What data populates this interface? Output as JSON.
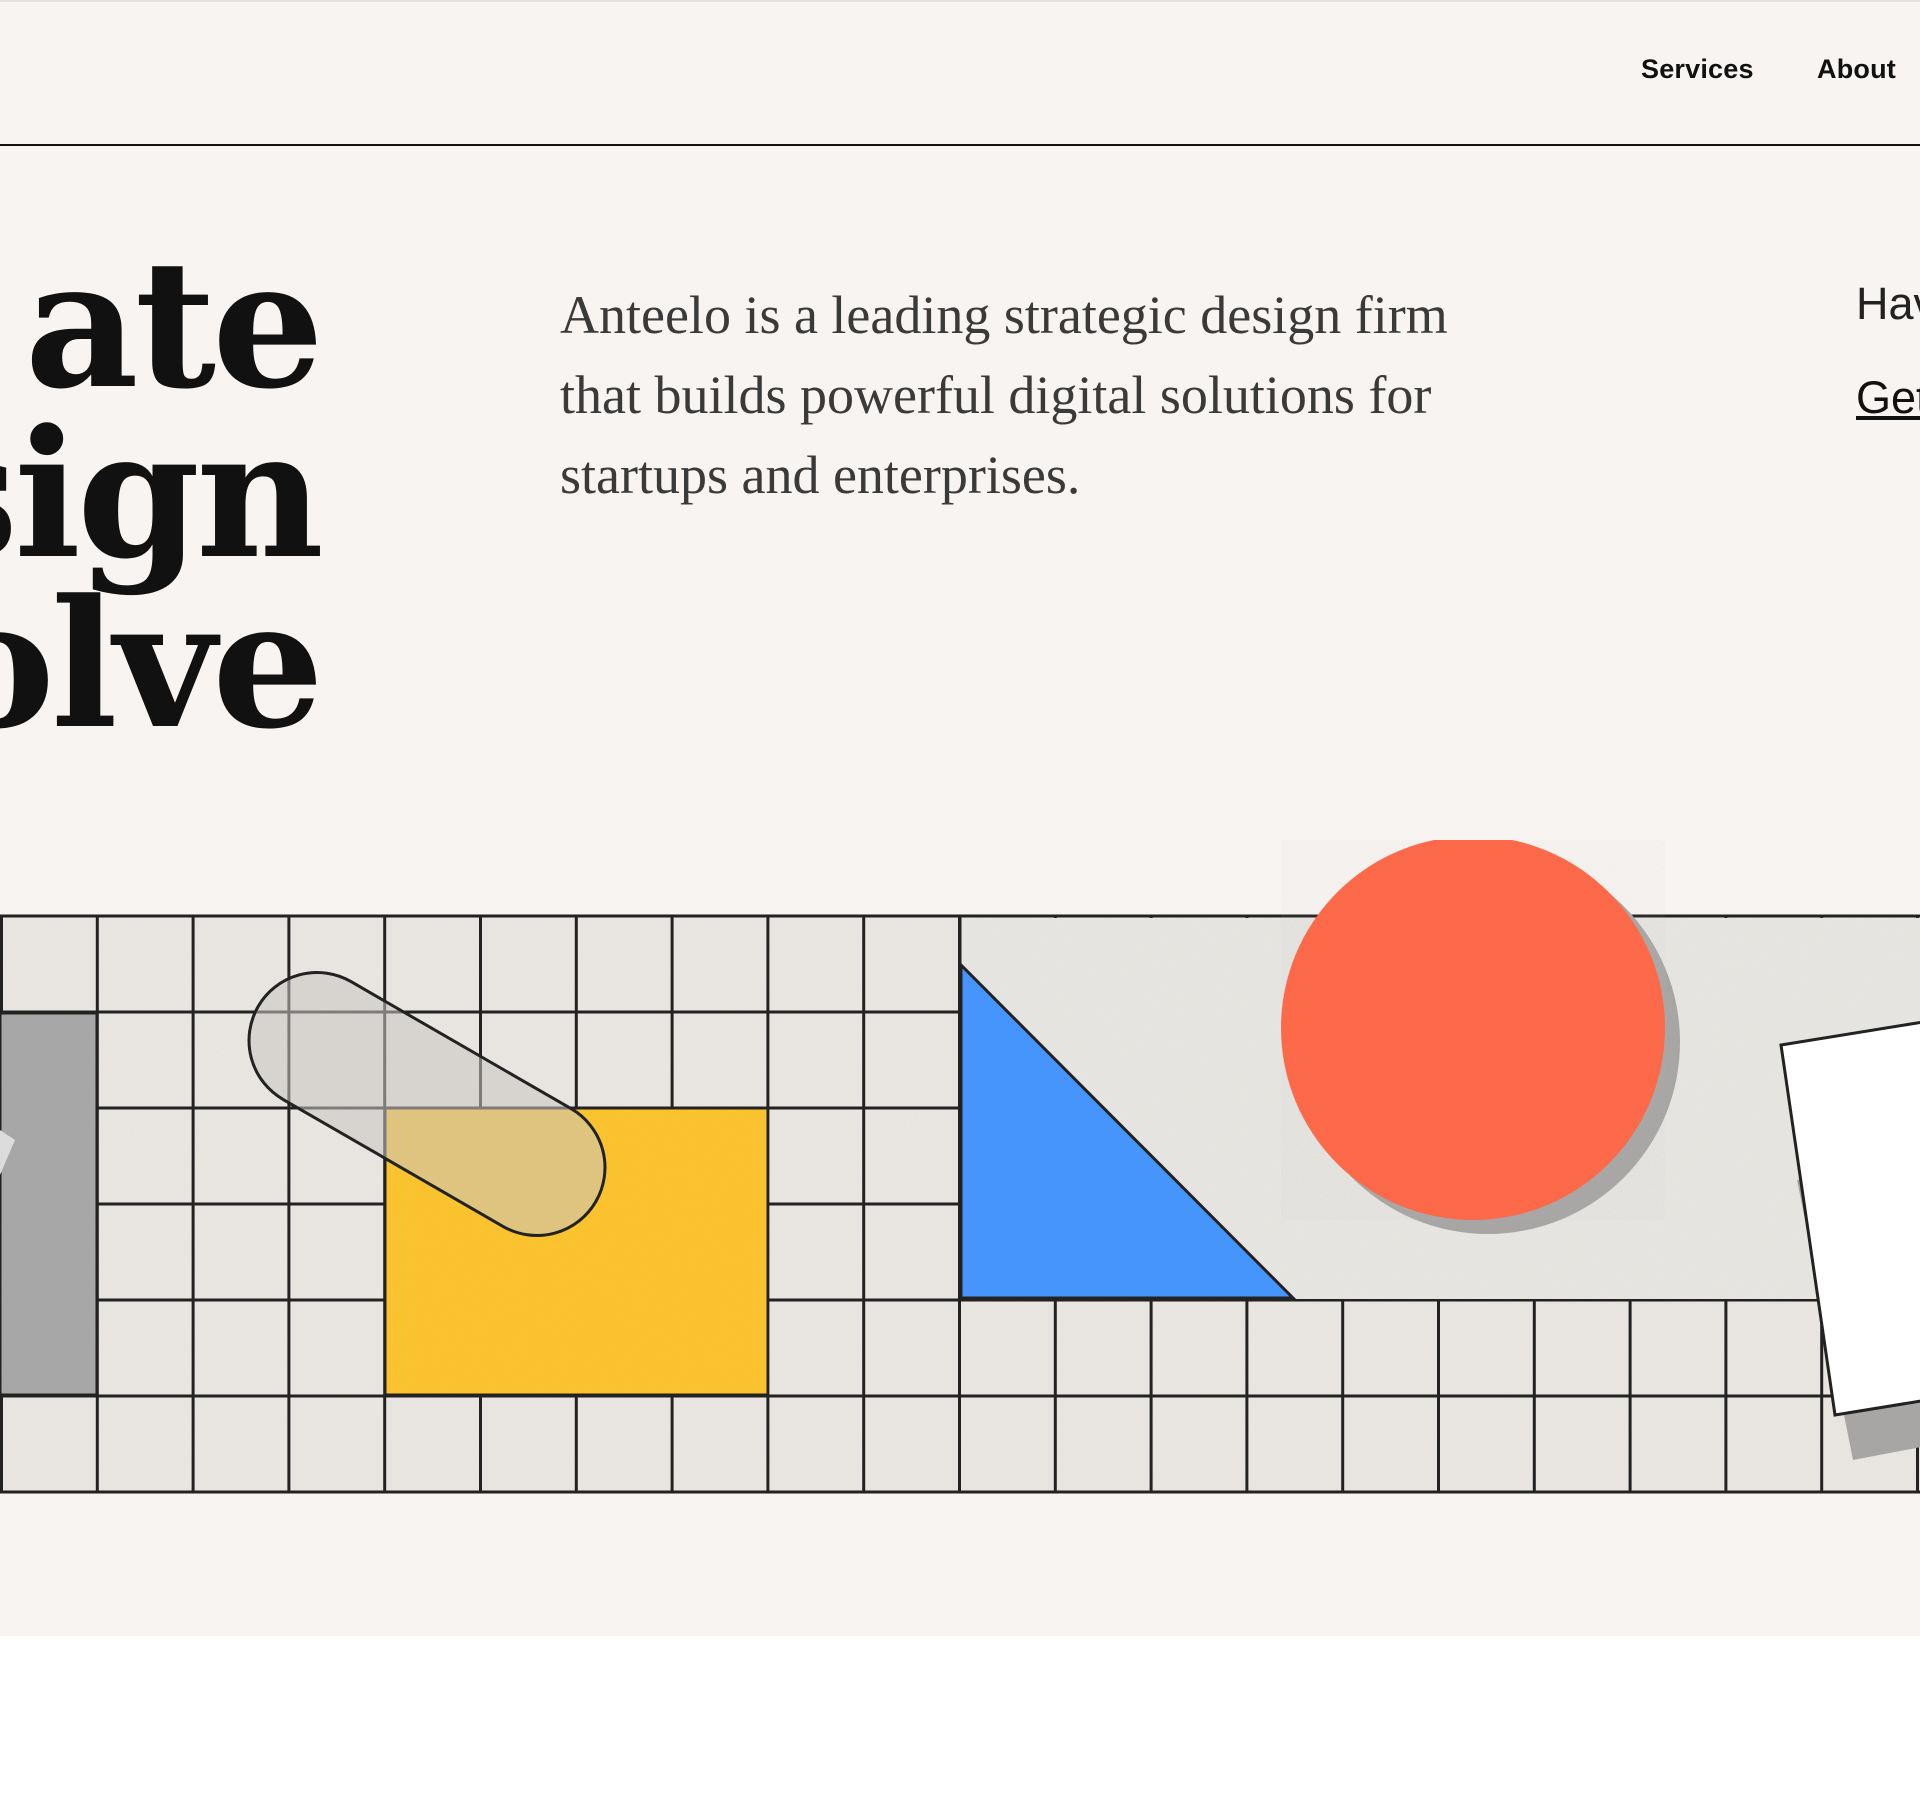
{
  "nav": {
    "items": [
      {
        "label": "Services"
      },
      {
        "label": "About"
      }
    ]
  },
  "hero": {
    "headline_lines": [
      "ate",
      "sign",
      "olve"
    ],
    "description_lines": [
      "Anteelo is a leading strategic design firm",
      "that builds powerful digital solutions for",
      "startups and enterprises."
    ],
    "cta_question": "Hav",
    "cta_link": "Get"
  },
  "illustration": {
    "colors": {
      "grid_fill": "#ebe8e4",
      "grid_line": "#222222",
      "yellow": "#fdc52f",
      "blue": "#4595fc",
      "coral": "#ff6b4b",
      "gray_block": "#a9a9a9",
      "shadow": "#a7a6a4",
      "white_card": "#ffffff"
    }
  }
}
